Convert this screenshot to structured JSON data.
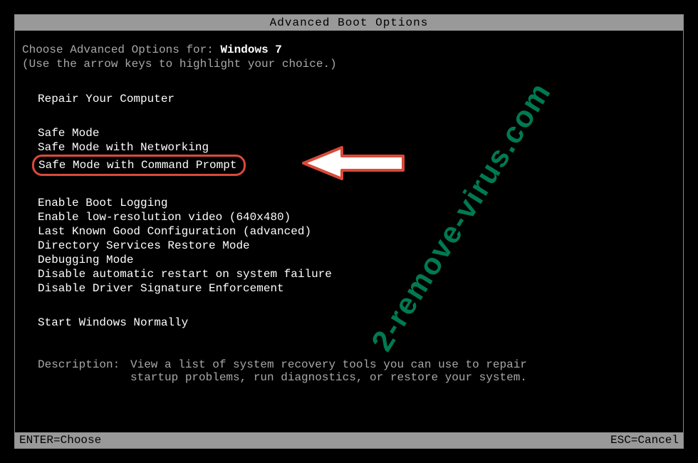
{
  "header": {
    "title": "Advanced Boot Options"
  },
  "prompt": {
    "prefix": "Choose Advanced Options for: ",
    "os": "Windows 7",
    "hint": "(Use the arrow keys to highlight your choice.)"
  },
  "group1": {
    "item0": "Repair Your Computer"
  },
  "group2": {
    "item0": "Safe Mode",
    "item1": "Safe Mode with Networking",
    "item2": "Safe Mode with Command Prompt"
  },
  "group3": {
    "item0": "Enable Boot Logging",
    "item1": "Enable low-resolution video (640x480)",
    "item2": "Last Known Good Configuration (advanced)",
    "item3": "Directory Services Restore Mode",
    "item4": "Debugging Mode",
    "item5": "Disable automatic restart on system failure",
    "item6": "Disable Driver Signature Enforcement"
  },
  "group4": {
    "item0": "Start Windows Normally"
  },
  "description": {
    "label": "Description:",
    "text": "View a list of system recovery tools you can use to repair startup problems, run diagnostics, or restore your system."
  },
  "footer": {
    "left": "ENTER=Choose",
    "right": "ESC=Cancel"
  },
  "watermark": "2-remove-virus.com"
}
